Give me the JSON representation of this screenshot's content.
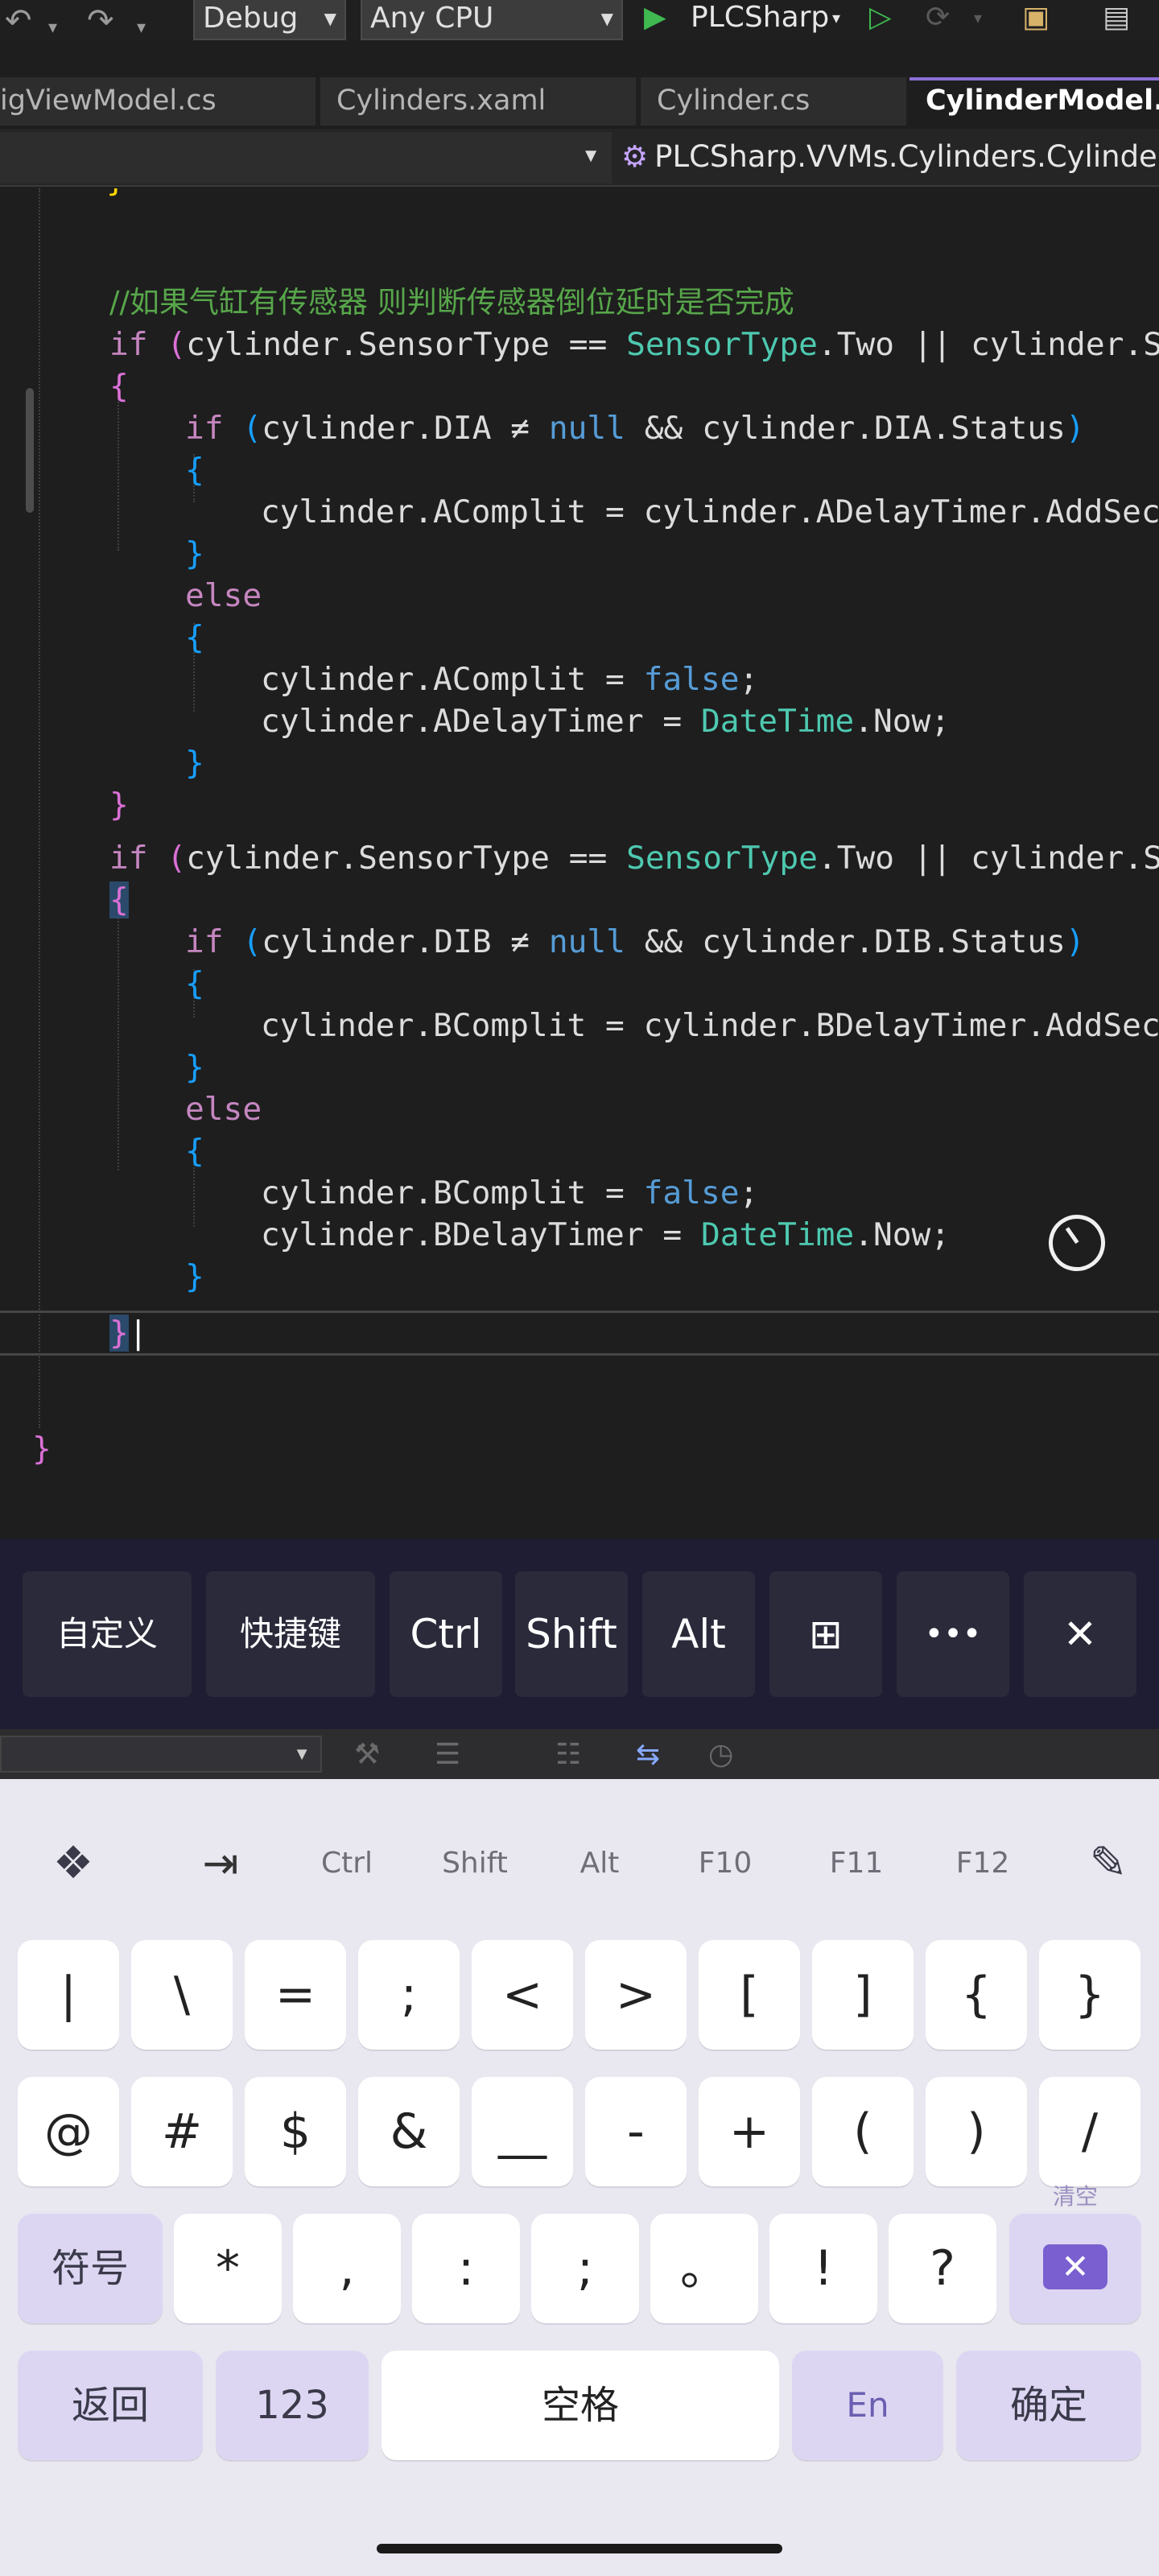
{
  "toolbar": {
    "config": "Debug",
    "platform": "Any CPU",
    "run_label": "PLCSharp"
  },
  "tabs": [
    "igViewModel.cs",
    "Cylinders.xaml",
    "Cylinder.cs",
    "CylinderModel.cs"
  ],
  "navbar": {
    "path": "PLCSharp.VVMs.Cylinders.CylinderM"
  },
  "editor": {
    "comment": "//如果气缸有传感器 则判断传感器倒位延时是否完成"
  },
  "quickbar": {
    "keys": [
      "自定义",
      "快捷键",
      "Ctrl",
      "Shift",
      "Alt",
      "⊞",
      "•••",
      "✕"
    ]
  },
  "keyboard": {
    "function_row": [
      "Ctrl",
      "Shift",
      "Alt",
      "F10",
      "F11",
      "F12"
    ],
    "row1": [
      "|",
      "\\",
      "=",
      ";",
      "<",
      ">",
      "[",
      "]",
      "{",
      "}"
    ],
    "row2": [
      "@",
      "#",
      "$",
      "&",
      "__",
      "-",
      "+",
      "(",
      ")",
      "/"
    ],
    "row3": [
      "符号",
      "*",
      ",",
      ":",
      ";",
      "。",
      "!",
      "?"
    ],
    "clear_label": "清空",
    "row4": [
      "返回",
      "123",
      "空格",
      "En",
      "确定"
    ]
  }
}
